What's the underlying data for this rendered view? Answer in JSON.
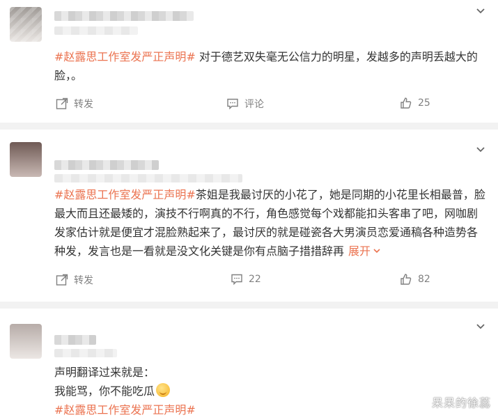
{
  "colors": {
    "topic": "#eb7350",
    "text": "#333333",
    "muted": "#808080",
    "divider": "#f2f2f2"
  },
  "comments": [
    {
      "topic": "#赵露思工作室发严正声明#",
      "body": "对于德艺双失毫无公信力的明星，发越多的声明丢越大的脸，。",
      "repost_label": "转发",
      "comment_label": "评论",
      "like_count": "25",
      "icons": [
        "repost-icon",
        "comment-icon",
        "like-icon",
        "chevron-down-icon"
      ]
    },
    {
      "topic": "#赵露思工作室发严正声明#",
      "body": "茶姐是我最讨厌的小花了，她是同期的小花里长相最普，脸最大而且还最矮的，演技不行啊真的不行，角色感觉每个戏都能扣头客串了吧，网咖剧发家估计就是便宜才混脸熟起来了，最讨厌的就是碰瓷各大男演员恋爱通稿各种造势各种发，发言也是一看就是没文化关键是你有点脑子措措辞再",
      "expand_label": "展开",
      "repost_label": "转发",
      "comment_count": "22",
      "like_count": "82",
      "icons": [
        "repost-icon",
        "comment-icon",
        "like-icon",
        "chevron-down-icon"
      ]
    },
    {
      "line1": "声明翻译过来就是：",
      "line2": "我能骂，你不能吃瓜",
      "emoji": "yummy-face-emoji",
      "topic": "#赵露思工作室发严正声明#",
      "icons": [
        "chevron-down-icon"
      ]
    }
  ],
  "watermark": "呆呆的徐蕊"
}
